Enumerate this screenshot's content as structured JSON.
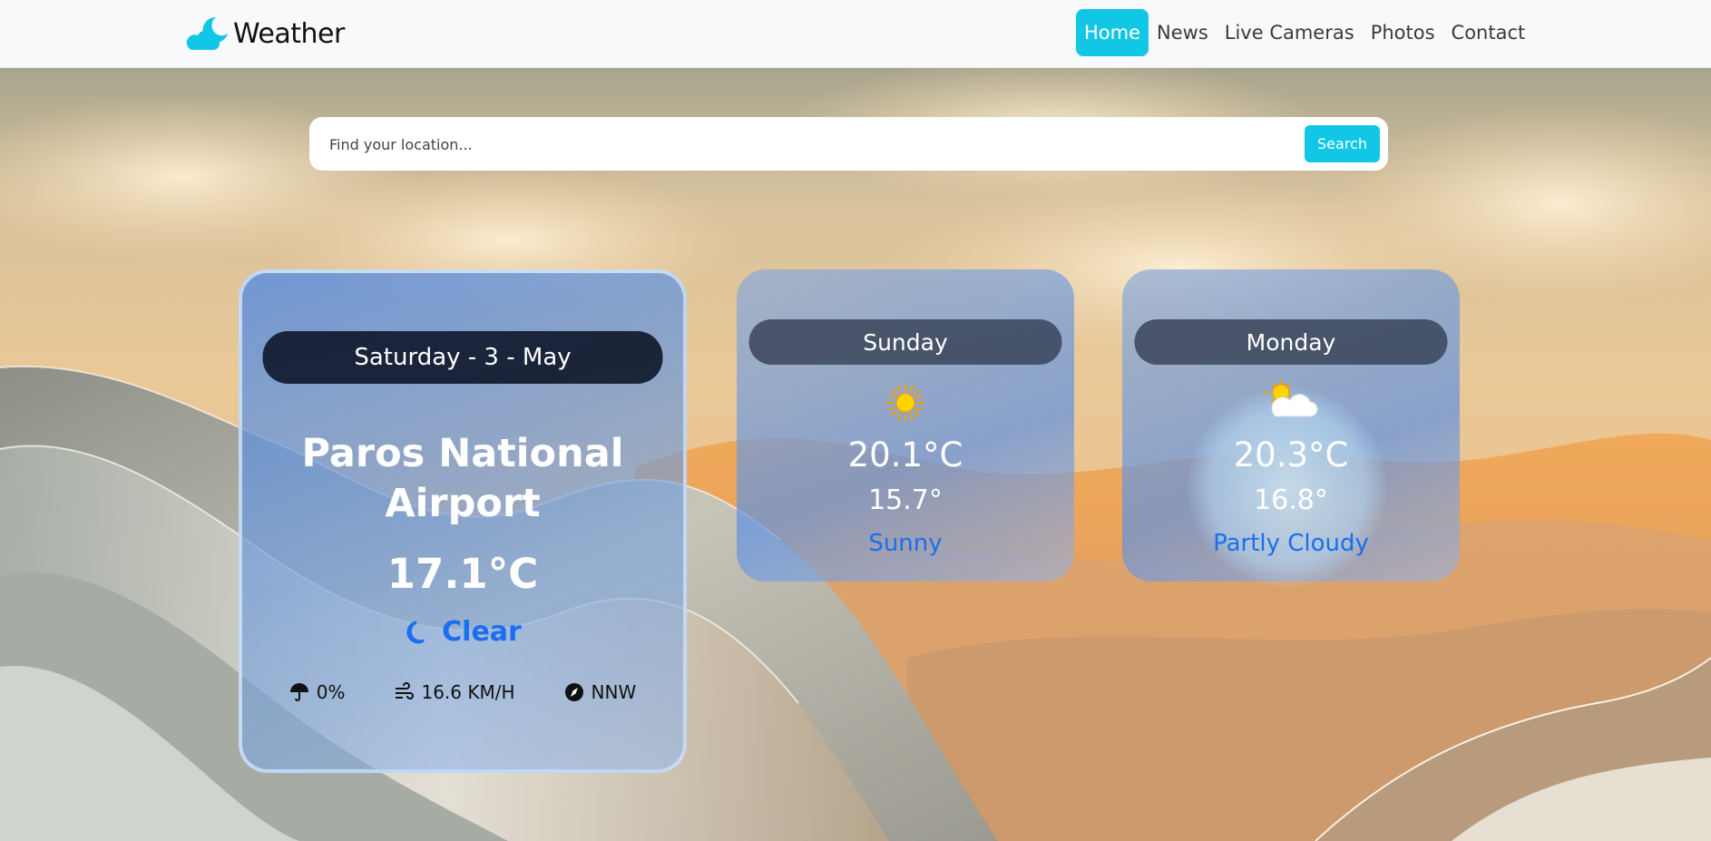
{
  "brand": {
    "name": "Weather",
    "icon": "moon-cloud-icon",
    "color": "#12c7e6"
  },
  "nav": {
    "items": [
      {
        "label": "Home",
        "active": true
      },
      {
        "label": "News",
        "active": false
      },
      {
        "label": "Live Cameras",
        "active": false
      },
      {
        "label": "Photos",
        "active": false
      },
      {
        "label": "Contact",
        "active": false
      }
    ]
  },
  "search": {
    "placeholder": "Find your location...",
    "value": "",
    "button_label": "Search"
  },
  "today": {
    "date_label": "Saturday - 3 - May",
    "location": "Paros National Airport",
    "temperature": "17.1°C",
    "condition": "Clear",
    "condition_icon": "crescent-moon-icon",
    "rain_chance": "0%",
    "wind_speed": "16.6 KM/H",
    "wind_direction": "NNW"
  },
  "forecast": [
    {
      "day": "Sunday",
      "max": "20.1°C",
      "min": "15.7°",
      "condition": "Sunny",
      "icon": "sun-icon"
    },
    {
      "day": "Monday",
      "max": "20.3°C",
      "min": "16.8°",
      "condition": "Partly Cloudy",
      "icon": "sun-cloud-icon"
    }
  ],
  "colors": {
    "accent": "#12c7e6",
    "condition_text": "#1a6ff0"
  }
}
